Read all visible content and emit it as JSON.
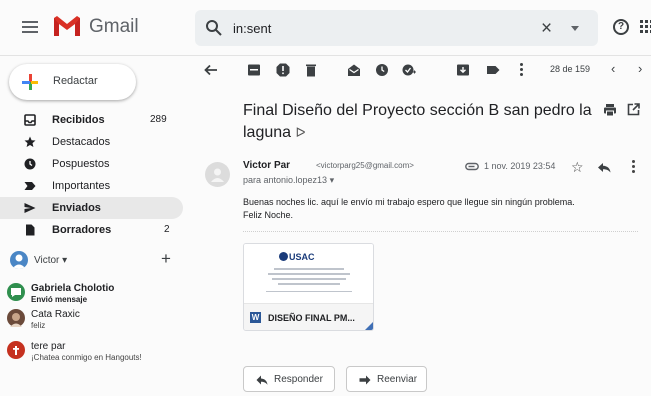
{
  "app": {
    "name": "Gmail"
  },
  "colors": {
    "gmail_red": "#d93025",
    "accent_blue": "#1a73e8",
    "compose_yellow": "#fbbc04"
  },
  "search": {
    "value": "in:sent",
    "clear_label": "×"
  },
  "help_label": "?",
  "compose": {
    "label": "Redactar"
  },
  "sidebar": {
    "items": [
      {
        "label": "Recibidos",
        "count": "289",
        "icon": "inbox-icon",
        "bold": true
      },
      {
        "label": "Destacados",
        "count": "",
        "icon": "star-icon"
      },
      {
        "label": "Pospuestos",
        "count": "",
        "icon": "clock-icon"
      },
      {
        "label": "Importantes",
        "count": "",
        "icon": "important-icon"
      },
      {
        "label": "Enviados",
        "count": "",
        "icon": "send-icon",
        "bold": true,
        "active": true
      },
      {
        "label": "Borradores",
        "count": "2",
        "icon": "draft-icon",
        "bold": true
      }
    ]
  },
  "hangouts": {
    "user": "Victor ▾",
    "add_label": "+",
    "contacts": [
      {
        "name": "Gabriela Cholotio",
        "status": "Envió mensaje",
        "bold": true,
        "color": "#2f8f4e"
      },
      {
        "name": "Cata Raxic",
        "status": "feliz",
        "bold": false,
        "color": "#6b4a3a"
      },
      {
        "name": "tere par",
        "status": "¡Chatea conmigo en Hangouts!",
        "bold": false,
        "color": "#c5311f"
      }
    ]
  },
  "toolbar": {
    "page_count": "28 de 159",
    "prev": "‹",
    "next": "›"
  },
  "message": {
    "subject": "Final Diseño del Proyecto sección B san pedro la laguna",
    "label_icon": "ᐅ",
    "sender_name": "Victor Par",
    "sender_email": "<victorparg25@gmail.com>",
    "recipient": "para antonio.lopez13 ▾",
    "date": "1 nov. 2019 23:54",
    "body": [
      "Buenas noches lic. aquí le envío mi trabajo espero que llegue sin ningún problema.",
      "Feliz Noche."
    ],
    "attachment": {
      "name": "DISEÑO FINAL PM...",
      "preview_title": "USAC",
      "type_letter": "W"
    }
  },
  "actions": {
    "reply": "Responder",
    "forward": "Reenviar"
  }
}
